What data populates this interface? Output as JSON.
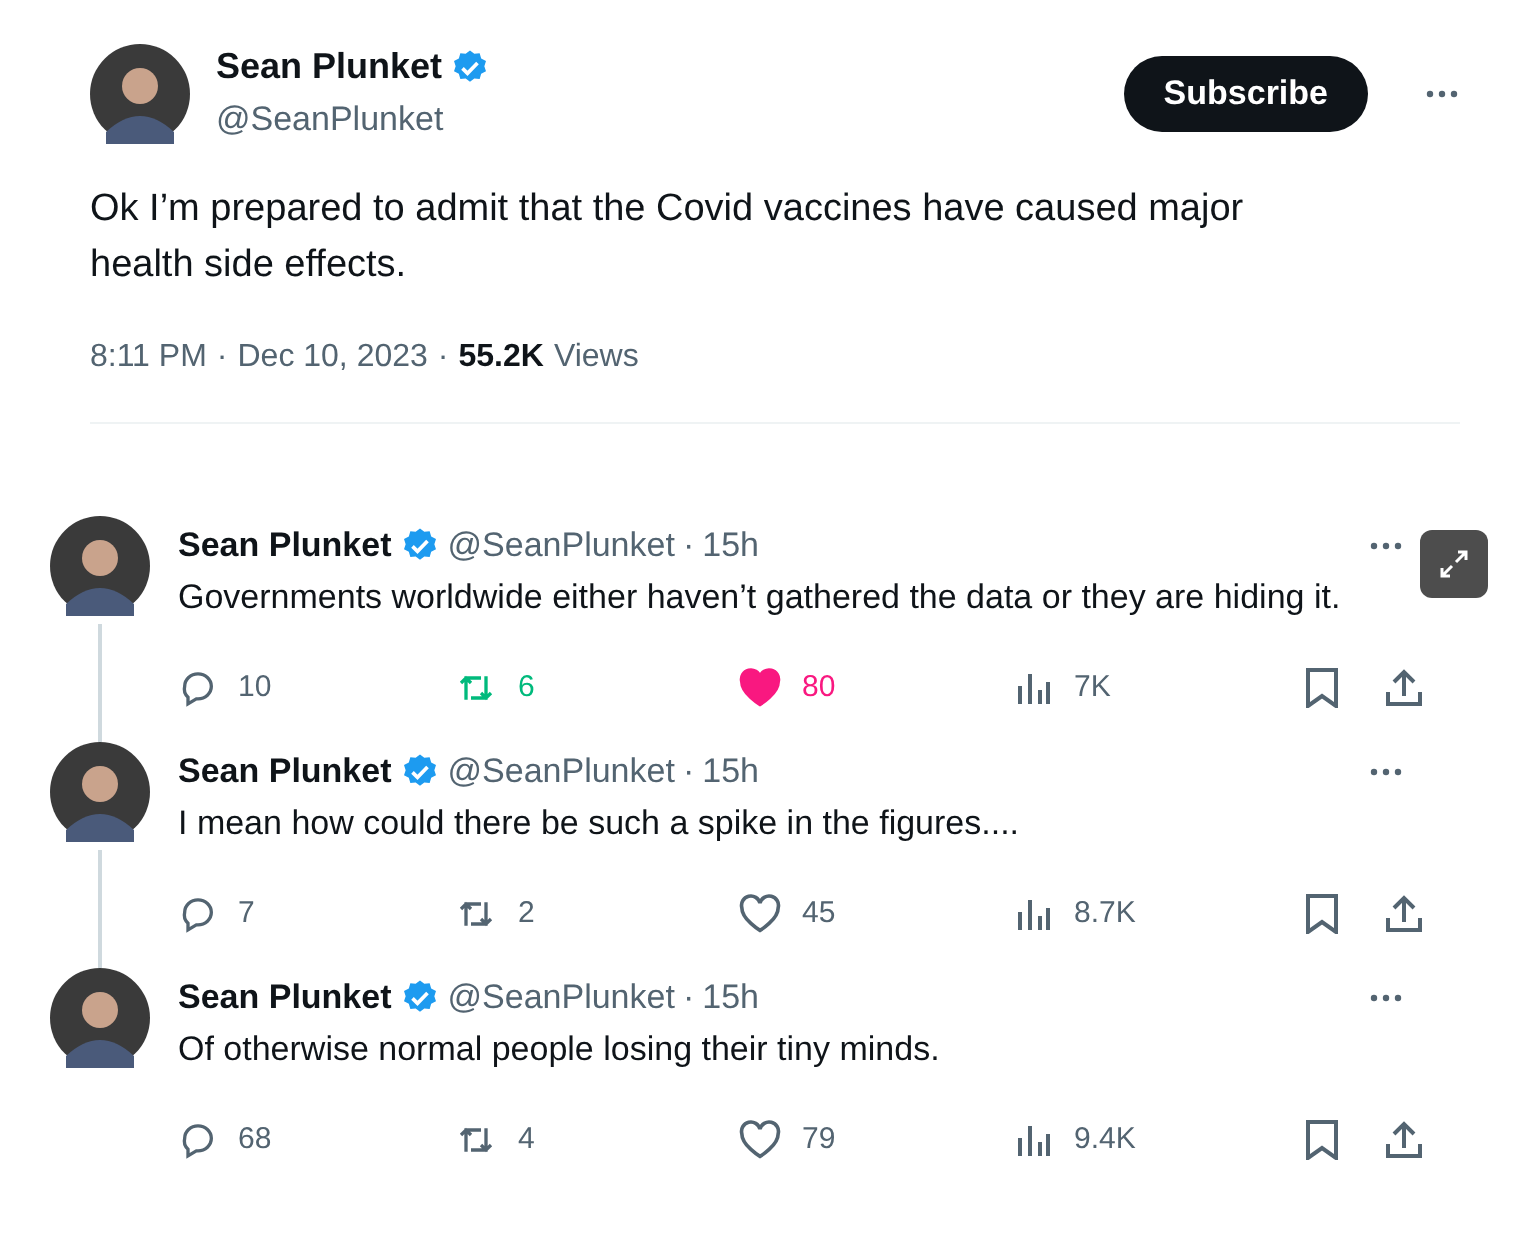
{
  "main_tweet": {
    "author": {
      "name": "Sean Plunket",
      "handle": "@SeanPlunket",
      "verified": true
    },
    "subscribe_button": "Subscribe",
    "text": "Ok I’m prepared to admit that the Covid vaccines have caused major health side effects.",
    "time": "8:11 PM",
    "date": "Dec 10, 2023",
    "separator_1": "·",
    "separator_2": "·",
    "views_count": "55.2K",
    "views_label": "Views"
  },
  "replies": [
    {
      "name": "Sean Plunket",
      "verified": true,
      "handle": "@SeanPlunket",
      "separator": "·",
      "age": "15h",
      "text": "Governments worldwide either haven’t gathered the data or they are hiding it.",
      "replies": "10",
      "reposts": "6",
      "reposted": true,
      "likes": "80",
      "liked": true,
      "views": "7K",
      "thread_line": true
    },
    {
      "name": "Sean Plunket",
      "verified": true,
      "handle": "@SeanPlunket",
      "separator": "·",
      "age": "15h",
      "text": "I mean how could there be such a spike in the figures....",
      "replies": "7",
      "reposts": "2",
      "reposted": false,
      "likes": "45",
      "liked": false,
      "views": "8.7K",
      "thread_line": true
    },
    {
      "name": "Sean Plunket",
      "verified": true,
      "handle": "@SeanPlunket",
      "separator": "·",
      "age": "15h",
      "text": "Of otherwise normal people losing their tiny minds.",
      "replies": "68",
      "reposts": "4",
      "reposted": false,
      "likes": "79",
      "liked": false,
      "views": "9.4K",
      "thread_line": false
    }
  ]
}
